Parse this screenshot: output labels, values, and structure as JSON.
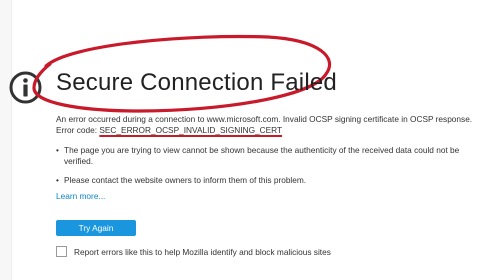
{
  "page": {
    "title": "Secure Connection Failed",
    "error_intro": "An error occurred during a connection to www.microsoft.com. Invalid OCSP signing certificate in OCSP response. Error code: ",
    "error_code": "SEC_ERROR_OCSP_INVALID_SIGNING_CERT",
    "bullets": [
      "The page you are trying to view cannot be shown because the authenticity of the received data could not be verified.",
      "Please contact the website owners to inform them of this problem."
    ],
    "learn_more": "Learn more...",
    "try_again": "Try Again",
    "report_label": "Report errors like this to help Mozilla identify and block malicious sites",
    "report_checked": false
  },
  "icons": {
    "info": "info-icon"
  },
  "colors": {
    "annotation_red": "#c81a2a",
    "button_blue": "#1a96de",
    "link_blue": "#0a84c9",
    "text": "#333333",
    "icon": "#333333"
  }
}
